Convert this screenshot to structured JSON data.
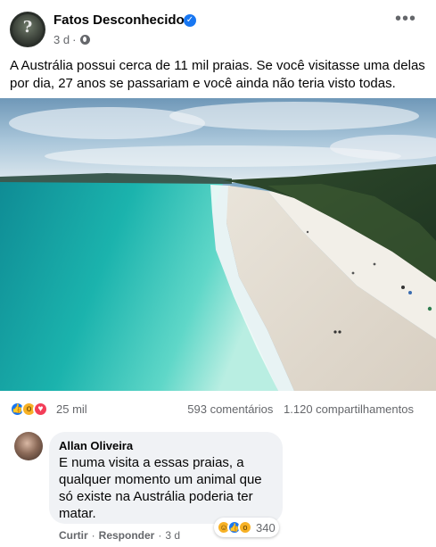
{
  "post": {
    "page_name": "Fatos Desconhecidos",
    "time": "3 d",
    "separator": "·",
    "more": "•••",
    "text": "A Austrália possui cerca de 11 mil praias. Se você visitasse uma delas por dia, 27 anos se passariam e você ainda não teria visto todas.",
    "reactions": [
      "like",
      "wow",
      "love"
    ],
    "reaction_count": "25 mil",
    "comments_count": "593 comentários",
    "shares_count": "1.120 compartilhamentos"
  },
  "comment": {
    "author": "Allan Oliveira",
    "text": "E numa visita a essas praias, a qualquer momento um animal que só existe na Austrália poderia ter matar.",
    "reactions": [
      "haha",
      "like",
      "wow"
    ],
    "reaction_count": "340",
    "like_label": "Curtir",
    "reply_label": "Responder",
    "separator": "·",
    "time": "3 d"
  },
  "colors": {
    "accent": "#1877f2",
    "muted_text": "#65676b",
    "bubble": "#f0f2f5"
  },
  "icons": {
    "verified": "verified-badge-icon",
    "audience": "globe-icon",
    "menu": "more-options-icon"
  }
}
